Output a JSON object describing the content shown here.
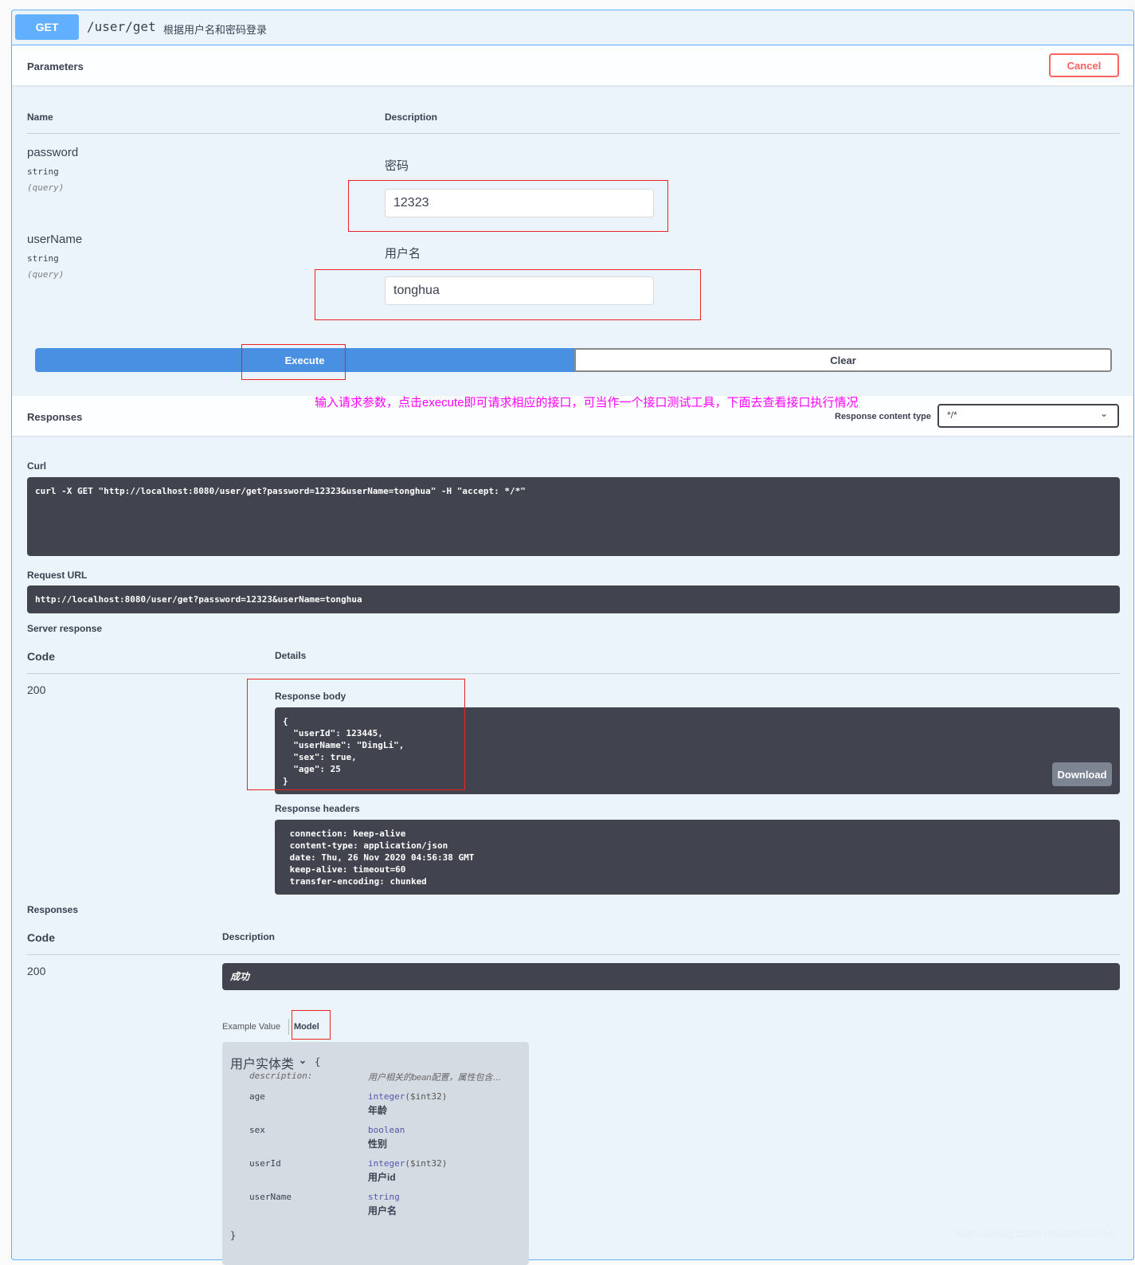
{
  "operation": {
    "method": "GET",
    "path": "/user/get",
    "summary": "根据用户名和密码登录"
  },
  "parameters": {
    "title": "Parameters",
    "cancel": "Cancel",
    "col_name": "Name",
    "col_desc": "Description",
    "items": [
      {
        "name": "password",
        "type": "string",
        "in": "(query)",
        "description": "密码",
        "value": "12323"
      },
      {
        "name": "userName",
        "type": "string",
        "in": "(query)",
        "description": "用户名",
        "value": "tonghua"
      }
    ]
  },
  "actions": {
    "execute": "Execute",
    "clear": "Clear"
  },
  "annotation": "输入请求参数，点击execute即可请求相应的接口，可当作一个接口测试工具，下面去查看接口执行情况",
  "responses_header": {
    "title": "Responses",
    "content_type_label": "Response content type",
    "content_type": "*/*"
  },
  "curl": {
    "label": "Curl",
    "value": "curl -X GET \"http://localhost:8080/user/get?password=12323&userName=tonghua\" -H \"accept: */*\""
  },
  "request_url": {
    "label": "Request URL",
    "value": "http://localhost:8080/user/get?password=12323&userName=tonghua"
  },
  "server_response": {
    "label": "Server response",
    "col_code": "Code",
    "col_details": "Details",
    "code": "200",
    "body_label": "Response body",
    "body": "{\n  \"userId\": 123445,\n  \"userName\": \"DingLi\",\n  \"sex\": true,\n  \"age\": 25\n}",
    "download": "Download",
    "headers_label": "Response headers",
    "headers": " connection: keep-alive\n content-type: application/json\n date: Thu, 26 Nov 2020 04:56:38 GMT\n keep-alive: timeout=60\n transfer-encoding: chunked"
  },
  "responses": {
    "label": "Responses",
    "col_code": "Code",
    "col_desc": "Description",
    "code": "200",
    "desc": "成功",
    "tab_example": "Example Value",
    "tab_model": "Model",
    "model": {
      "name": "用户实体类",
      "brace_open": "{",
      "brace_close": "}",
      "description_key": "description:",
      "description": "用户相关的bean配置，属性包含…",
      "fields": [
        {
          "name": "age",
          "type": "integer",
          "format": "($int32)",
          "desc": "年龄"
        },
        {
          "name": "sex",
          "type": "boolean",
          "format": "",
          "desc": "性别"
        },
        {
          "name": "userId",
          "type": "integer",
          "format": "($int32)",
          "desc": "用户id"
        },
        {
          "name": "userName",
          "type": "string",
          "format": "",
          "desc": "用户名"
        }
      ]
    }
  },
  "watermark": "https://blog.csdn.net/dl962454",
  "colors": {
    "get": "#61affe",
    "execute": "#4990e2",
    "cancel": "#ff6060",
    "annotation": "#ff00ff",
    "dark": "#41444e"
  }
}
